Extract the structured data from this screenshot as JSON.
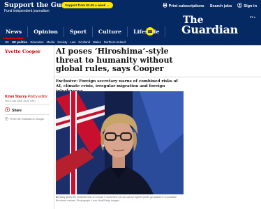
{
  "header": {
    "support_title": "Support the Guardian",
    "support_subtitle": "Fund independent journalism",
    "support_button": "Support from $3.45 a week →",
    "links": [
      {
        "label": "Print subscriptions",
        "icon": "print-icon"
      },
      {
        "label": "Search jobs",
        "icon": "search-icon"
      },
      {
        "label": "Sign in",
        "icon": "account-icon"
      }
    ],
    "edition": "Int",
    "logo_the": "The",
    "logo_guardian": "Guardian",
    "pillars": [
      "News",
      "Opinion",
      "Sport",
      "Culture",
      "Lifestyle"
    ],
    "subnav": [
      "UK",
      "UK politics",
      "Education",
      "Media",
      "Society",
      "Law",
      "Scotland",
      "Wales",
      "Northern Ireland"
    ]
  },
  "colors": {
    "brand_blue": "#052962",
    "support_yellow": "#ffe500",
    "news_red": "#c70000"
  },
  "article": {
    "section": "Yvette Cooper",
    "headline": "AI poses ‘Hiroshima’-style threat to humanity without global rules, says Cooper",
    "standfirst": "Exclusive: Foreign secretary warns of combined risks of AI, climate crisis, irregular migration and foreign interference",
    "byline_name": "Kiran Stacey",
    "byline_role": "Policy editor",
    "dateline": "Sun 5 Jan 2026 10.00 GMT",
    "share_label": "Share",
    "prefer_label": "Prefer the Guardian on Google",
    "caption_text": "Essay gives the clearest view of Cooper’s worldview yet as Labour figures jostle got places in a possible Burnham cabinet.",
    "caption_credit": "Photograph: Leon Neal/Getty Images"
  }
}
